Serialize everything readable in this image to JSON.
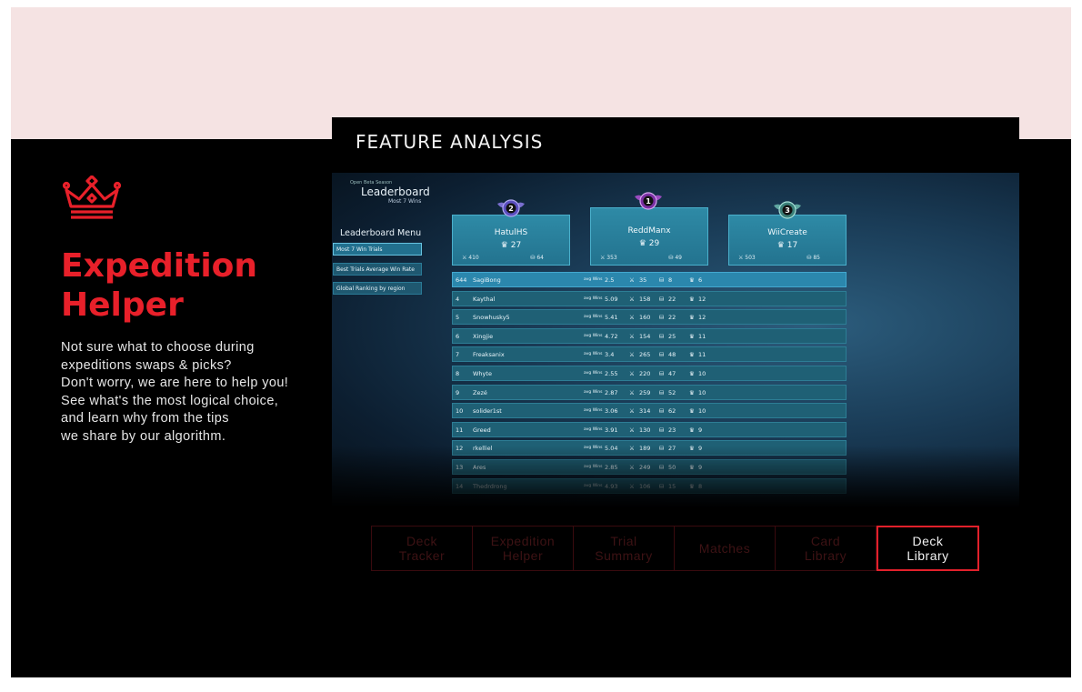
{
  "feature": {
    "title_line1": "Expedition",
    "title_line2": "Helper",
    "description": "Not sure what to choose during\nexpeditions swaps & picks?\nDon't worry, we are here to help you!\nSee what's the most logical choice,\nand learn why from the tips\nwe share by our algorithm.",
    "icon": "crown-icon",
    "accent_color": "#e8202a"
  },
  "panel": {
    "heading": "FEATURE ANALYSIS"
  },
  "leaderboard": {
    "season_label": "Open Beta Season",
    "title": "Leaderboard",
    "subtitle": "Most 7 Wins",
    "menu_title": "Leaderboard Menu",
    "menu_items": [
      {
        "label": "Most 7 Win Trials"
      },
      {
        "label": "Best Trials Average Win Rate"
      },
      {
        "label": "Global Ranking by region"
      }
    ],
    "podium": [
      {
        "rank": "2",
        "name": "HatulHS",
        "wins": "27",
        "games": "410",
        "cards": "64"
      },
      {
        "rank": "1",
        "name": "ReddManx",
        "wins": "29",
        "games": "353",
        "cards": "49"
      },
      {
        "rank": "3",
        "name": "WiiCreate",
        "wins": "17",
        "games": "503",
        "cards": "85"
      }
    ],
    "avg_label": "avg Wins",
    "rows": [
      {
        "rank": "644",
        "name": "SagiBong",
        "avg": "2.5",
        "games": "35",
        "cards": "8",
        "wins": "6"
      },
      {
        "rank": "4",
        "name": "Kaythal",
        "avg": "5.09",
        "games": "158",
        "cards": "22",
        "wins": "12"
      },
      {
        "rank": "5",
        "name": "Snowhusky5",
        "avg": "5.41",
        "games": "160",
        "cards": "22",
        "wins": "12"
      },
      {
        "rank": "6",
        "name": "Xingjie",
        "avg": "4.72",
        "games": "154",
        "cards": "25",
        "wins": "11"
      },
      {
        "rank": "7",
        "name": "Freaksanix",
        "avg": "3.4",
        "games": "265",
        "cards": "48",
        "wins": "11"
      },
      {
        "rank": "8",
        "name": "Whyte",
        "avg": "2.55",
        "games": "220",
        "cards": "47",
        "wins": "10"
      },
      {
        "rank": "9",
        "name": "Zezé",
        "avg": "2.87",
        "games": "259",
        "cards": "52",
        "wins": "10"
      },
      {
        "rank": "10",
        "name": "solider1st",
        "avg": "3.06",
        "games": "314",
        "cards": "62",
        "wins": "10"
      },
      {
        "rank": "11",
        "name": "Greed",
        "avg": "3.91",
        "games": "130",
        "cards": "23",
        "wins": "9"
      },
      {
        "rank": "12",
        "name": "rkelliel",
        "avg": "5.04",
        "games": "189",
        "cards": "27",
        "wins": "9"
      },
      {
        "rank": "13",
        "name": "Ares",
        "avg": "2.85",
        "games": "249",
        "cards": "50",
        "wins": "9"
      },
      {
        "rank": "14",
        "name": "Thedrdrong",
        "avg": "4.93",
        "games": "106",
        "cards": "15",
        "wins": "8"
      }
    ]
  },
  "tabs": [
    {
      "label": "Deck\nTracker",
      "active": false
    },
    {
      "label": "Expedition\nHelper",
      "active": false
    },
    {
      "label": "Trial\nSummary",
      "active": false
    },
    {
      "label": "Matches",
      "active": false
    },
    {
      "label": "Card\nLibrary",
      "active": false
    },
    {
      "label": "Deck\nLibrary",
      "active": true
    }
  ]
}
